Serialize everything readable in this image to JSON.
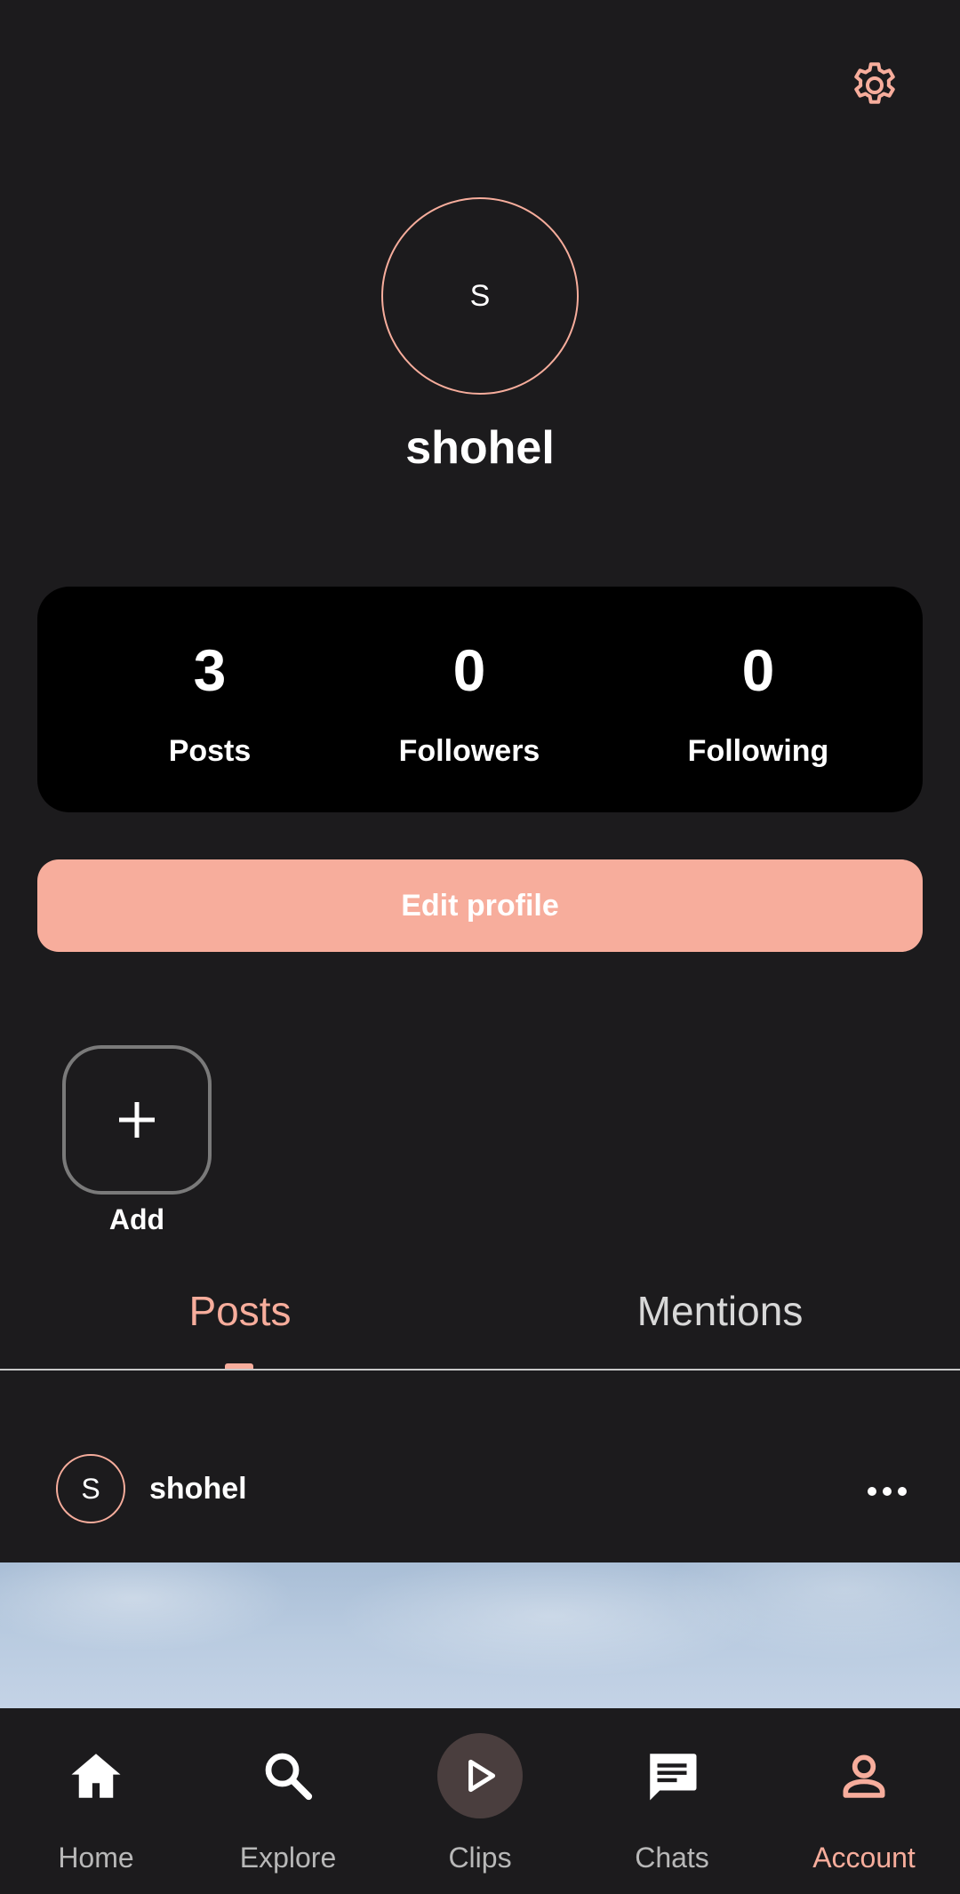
{
  "colors": {
    "accent": "#f7ad9c",
    "background": "#1c1b1d",
    "card": "#000000"
  },
  "header": {
    "settings_icon": "gear-icon"
  },
  "profile": {
    "avatar_initial": "S",
    "username": "shohel"
  },
  "stats": {
    "posts": {
      "value": "3",
      "label": "Posts"
    },
    "followers": {
      "value": "0",
      "label": "Followers"
    },
    "following": {
      "value": "0",
      "label": "Following"
    }
  },
  "edit_button": {
    "label": "Edit profile"
  },
  "highlights": {
    "add_label": "Add",
    "add_icon": "plus-icon"
  },
  "tabs": [
    {
      "label": "Posts",
      "active": true
    },
    {
      "label": "Mentions",
      "active": false
    }
  ],
  "post": {
    "avatar_initial": "S",
    "author": "shohel",
    "more_icon": "more-dots-icon"
  },
  "bottom_nav": [
    {
      "label": "Home",
      "icon": "home-icon",
      "active": false
    },
    {
      "label": "Explore",
      "icon": "search-icon",
      "active": false
    },
    {
      "label": "Clips",
      "icon": "play-icon",
      "active": false
    },
    {
      "label": "Chats",
      "icon": "chat-icon",
      "active": false
    },
    {
      "label": "Account",
      "icon": "account-icon",
      "active": true
    }
  ]
}
